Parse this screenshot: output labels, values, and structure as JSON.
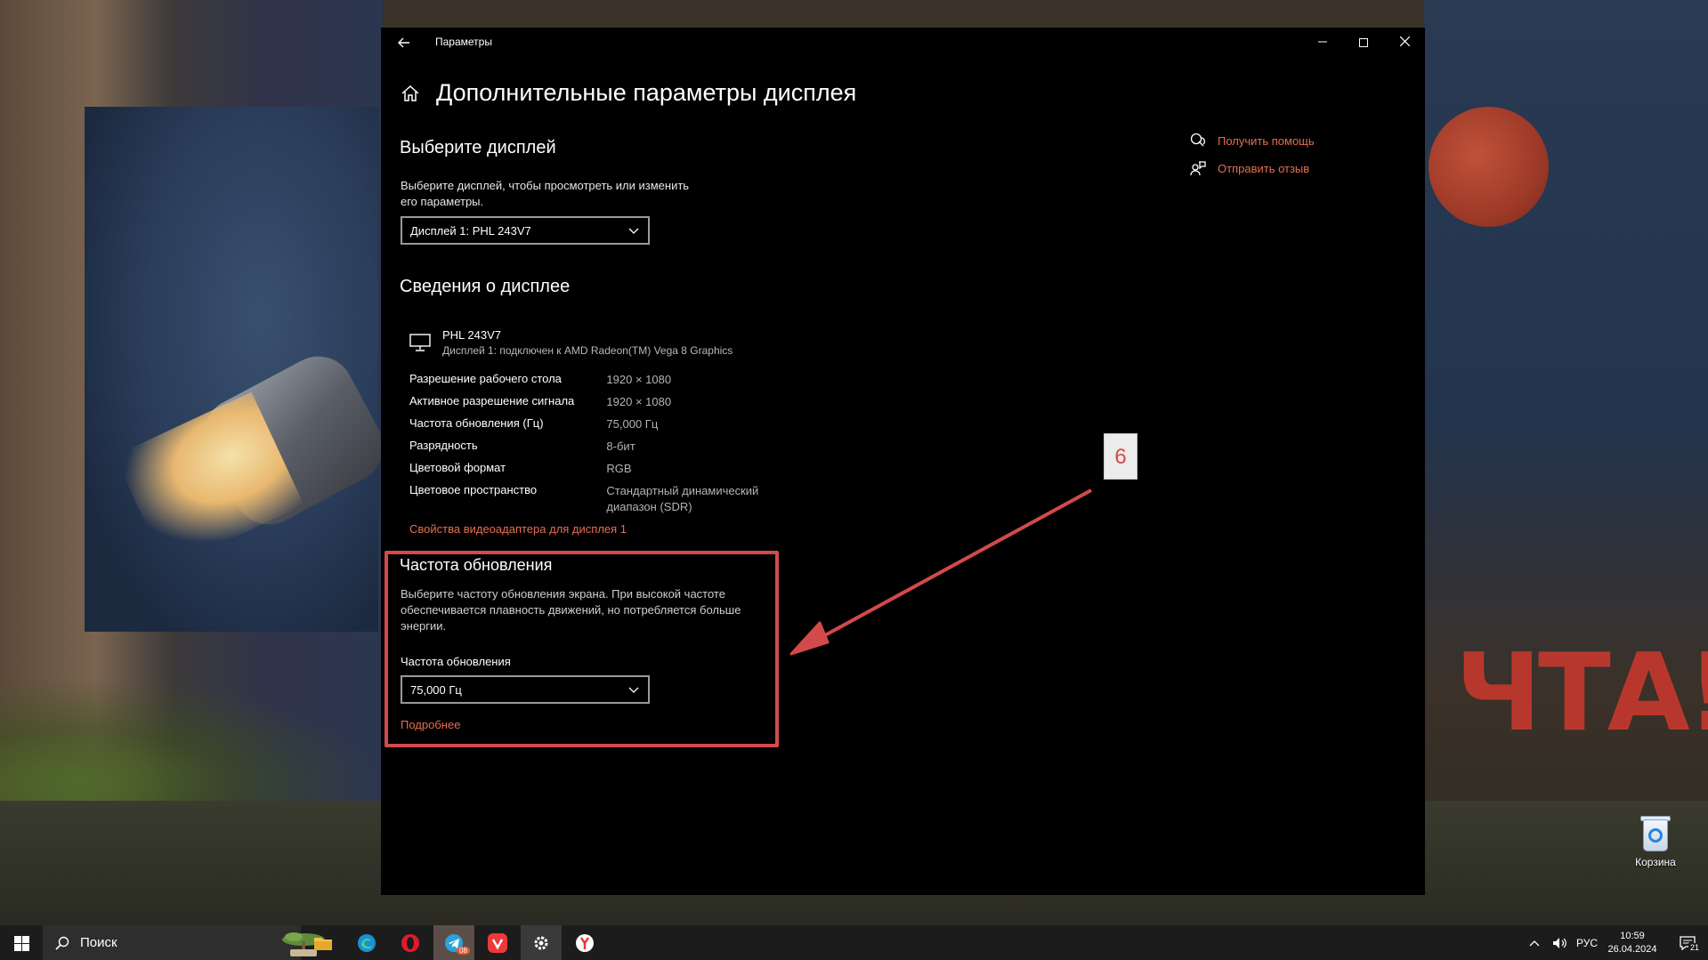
{
  "window": {
    "title": "Параметры",
    "page_title": "Дополнительные параметры дисплея"
  },
  "choose_display": {
    "title": "Выберите дисплей",
    "description": "Выберите дисплей, чтобы просмотреть или изменить его параметры.",
    "selected": "Дисплей 1: PHL 243V7"
  },
  "display_info": {
    "title": "Сведения о дисплее",
    "monitor_name": "PHL 243V7",
    "monitor_subtitle": "Дисплей 1: подключен к AMD Radeon(TM) Vega 8 Graphics",
    "rows": [
      {
        "label": "Разрешение рабочего стола",
        "value": "1920 × 1080"
      },
      {
        "label": "Активное разрешение сигнала",
        "value": "1920 × 1080"
      },
      {
        "label": "Частота обновления (Гц)",
        "value": "75,000 Гц"
      },
      {
        "label": "Разрядность",
        "value": "8-бит"
      },
      {
        "label": "Цветовой формат",
        "value": "RGB"
      },
      {
        "label": "Цветовое пространство",
        "value": "Стандартный динамический диапазон (SDR)"
      }
    ],
    "adapter_link": "Свойства видеоадаптера для дисплея 1"
  },
  "refresh_rate": {
    "title": "Частота обновления",
    "description": "Выберите частоту обновления экрана. При высокой частоте обеспечивается плавность движений, но потребляется больше энергии.",
    "field_label": "Частота обновления",
    "selected": "75,000 Гц",
    "more_link": "Подробнее"
  },
  "help": {
    "get_help": "Получить помощь",
    "feedback": "Отправить отзыв"
  },
  "annotation": {
    "step_number": "6",
    "color": "#d24a4a"
  },
  "desktop": {
    "recycle_bin_label": "Корзина",
    "wallpaper_text": "ЧТА!"
  },
  "taskbar": {
    "search_placeholder": "Поиск",
    "telegram_badge": "08",
    "language": "РУС",
    "time": "10:59",
    "date": "26.04.2024",
    "notification_count": "21",
    "apps": [
      "file-explorer",
      "edge",
      "opera",
      "telegram",
      "vivaldi",
      "settings",
      "yandex-browser"
    ]
  },
  "colors": {
    "accent_link": "#e46e54",
    "window_bg": "#000000",
    "taskbar_bg": "#1c1c1c"
  }
}
